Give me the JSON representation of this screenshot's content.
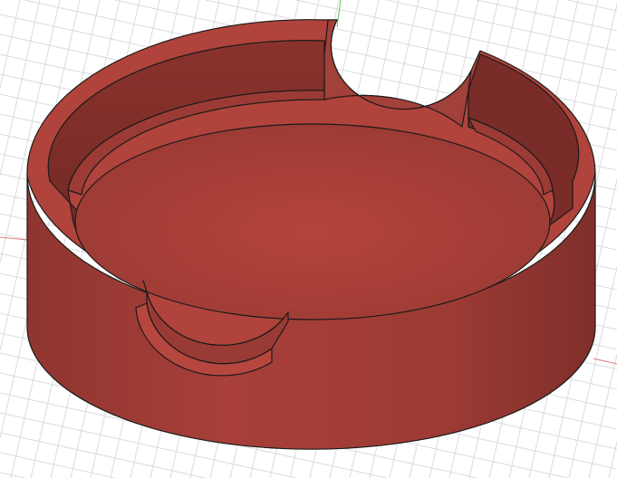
{
  "viewport": {
    "background": "#ffffff",
    "grid_color": "#d9dbde",
    "x_axis_color": "#e06a6a",
    "y_axis_color": "#4fc04f"
  },
  "model": {
    "name": "coaster",
    "body_color": "#a8403a",
    "body_dark": "#8c3430",
    "body_light": "#b9483f",
    "edge_color": "#1a1a1a"
  }
}
